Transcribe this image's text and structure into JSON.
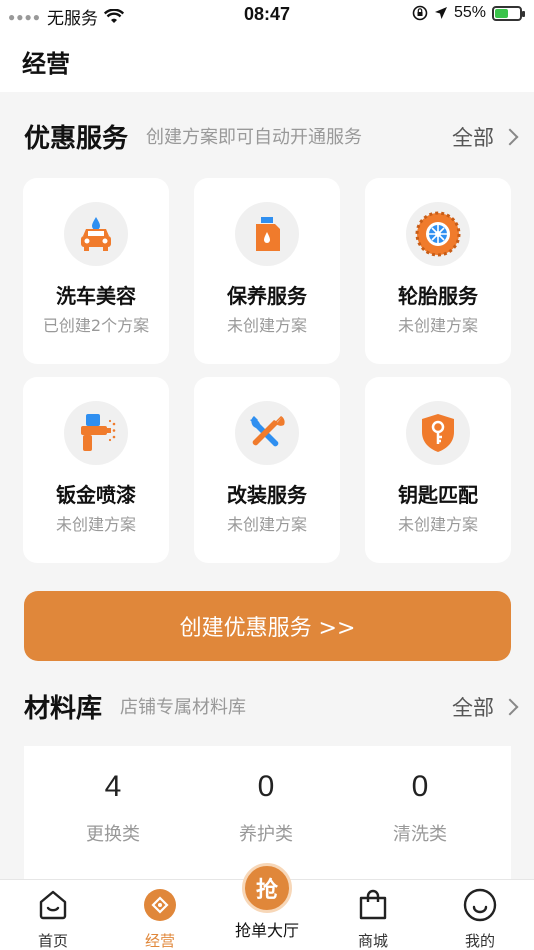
{
  "status_bar": {
    "carrier": "无服务",
    "time": "08:47",
    "battery_pct": "55%",
    "battery_level": 0.55
  },
  "header": {
    "title": "经营"
  },
  "discount": {
    "title": "优惠服务",
    "subtitle": "创建方案即可自动开通服务",
    "all_label": "全部",
    "items": [
      {
        "name": "洗车美容",
        "status": "已创建2个方案",
        "icon": "car-wash-icon"
      },
      {
        "name": "保养服务",
        "status": "未创建方案",
        "icon": "oil-can-icon"
      },
      {
        "name": "轮胎服务",
        "status": "未创建方案",
        "icon": "tire-icon"
      },
      {
        "name": "钣金喷漆",
        "status": "未创建方案",
        "icon": "spray-gun-icon"
      },
      {
        "name": "改装服务",
        "status": "未创建方案",
        "icon": "tools-icon"
      },
      {
        "name": "钥匙匹配",
        "status": "未创建方案",
        "icon": "key-shield-icon"
      }
    ],
    "create_button": "创建优惠服务 >>"
  },
  "materials": {
    "title": "材料库",
    "subtitle": "店铺专属材料库",
    "all_label": "全部",
    "stats": [
      {
        "value": "4",
        "label": "更换类"
      },
      {
        "value": "0",
        "label": "养护类"
      },
      {
        "value": "0",
        "label": "清洗类"
      }
    ]
  },
  "tabbar": {
    "tabs": [
      {
        "label": "首页",
        "icon": "home-icon"
      },
      {
        "label": "经营",
        "icon": "business-icon"
      },
      {
        "label": "抢单大厅",
        "icon": "grab-order-icon",
        "glyph": "抢"
      },
      {
        "label": "商城",
        "icon": "shopping-bag-icon"
      },
      {
        "label": "我的",
        "icon": "profile-icon"
      }
    ]
  },
  "colors": {
    "accent": "#e0873a",
    "icon_orange": "#f07b2c",
    "icon_blue": "#2f8ff0"
  }
}
